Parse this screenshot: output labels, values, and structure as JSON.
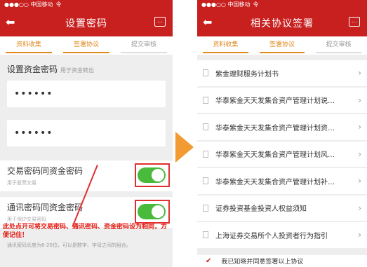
{
  "left": {
    "status": {
      "carrier": "●●●○○ 中国移动",
      "wifi": "令"
    },
    "title": "设置密码",
    "tabs": [
      {
        "label": "资料收集",
        "state": "done"
      },
      {
        "label": "签署协议",
        "state": "active"
      },
      {
        "label": "提交审核",
        "state": "inactive"
      }
    ],
    "section_label": "设置资金密码",
    "section_hint": "用于资金转出",
    "password1": "••••••",
    "password2": "••••••",
    "switch1": {
      "label": "交易密码同资金密码",
      "sub": "用于股票交易",
      "on": true
    },
    "switch2": {
      "label": "通讯密码同资金密码",
      "sub": "用于保护交易密码",
      "on": true
    },
    "annotation": "此处点开可将交易密码、通讯密码、资金密码设为相同，方便记住！",
    "footnote": "通讯密码长度为6-20位，可以是数字、字母之间的组合。"
  },
  "right": {
    "status": {
      "carrier": "●●●○○ 中国移动",
      "wifi": "令"
    },
    "title": "相关协议签署",
    "tabs": [
      {
        "label": "资料收集",
        "state": "done"
      },
      {
        "label": "签署协议",
        "state": "active"
      },
      {
        "label": "提交审核",
        "state": "inactive"
      }
    ],
    "documents": [
      "紫金理财服务计划书",
      "华泰紫金天天发集合资产管理计划说…",
      "华泰紫金天天发集合资产管理计划资…",
      "华泰紫金天天发集合资产管理计划风…",
      "华泰紫金天天发集合资产管理计划补…",
      "证券投资基金投资人权益须知",
      "上海证券交易所个人投资者行为指引"
    ],
    "agree_text": "我已知晓并同意签署以上协议"
  },
  "colors": {
    "brand": "#c81f1f",
    "accent": "#e08a1e",
    "toggle_on": "#4aba3c",
    "arrow": "#f29b33"
  }
}
